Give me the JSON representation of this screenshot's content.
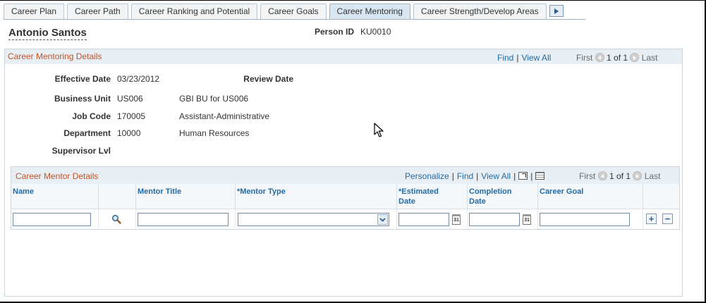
{
  "tabs": [
    {
      "label": "Career Plan",
      "active": false
    },
    {
      "label": "Career Path",
      "active": false
    },
    {
      "label": "Career Ranking and Potential",
      "active": false
    },
    {
      "label": "Career Goals",
      "active": false
    },
    {
      "label": "Career Mentoring",
      "active": true
    },
    {
      "label": "Career Strength/Develop Areas",
      "active": false
    }
  ],
  "person": {
    "name": "Antonio Santos",
    "id_label": "Person ID",
    "id_value": "KU0010"
  },
  "details": {
    "title": "Career Mentoring Details",
    "nav": {
      "find": "Find",
      "view_all": "View All",
      "first": "First",
      "count": "1 of 1",
      "last": "Last"
    },
    "effective_date_label": "Effective Date",
    "effective_date": "03/23/2012",
    "review_date_label": "Review Date",
    "business_unit_label": "Business Unit",
    "business_unit": "US006",
    "business_unit_desc": "GBI BU for US006",
    "job_code_label": "Job Code",
    "job_code": "170005",
    "job_code_desc": "Assistant-Administrative",
    "department_label": "Department",
    "department": "10000",
    "department_desc": "Human Resources",
    "supervisor_label": "Supervisor Lvl"
  },
  "mentor": {
    "title": "Career Mentor Details",
    "nav": {
      "personalize": "Personalize",
      "find": "Find",
      "view_all": "View All",
      "first": "First",
      "count": "1 of 1",
      "last": "Last"
    },
    "columns": {
      "name": "Name",
      "mentor_title": "Mentor Title",
      "mentor_type": "*Mentor Type",
      "est_date_1": "*Estimated",
      "est_date_2": "Date",
      "comp_date_1": "Completion",
      "comp_date_2": "Date",
      "career_goal": "Career Goal"
    },
    "row": {
      "name": "",
      "mentor_title": "",
      "mentor_type": "",
      "est_date": "",
      "comp_date": "",
      "career_goal": ""
    },
    "cal_text": "31",
    "add": "+",
    "remove": "−"
  },
  "colors": {
    "accent_title": "#c0552b",
    "link": "#246aa3",
    "header_bg": "#e7eef4"
  }
}
